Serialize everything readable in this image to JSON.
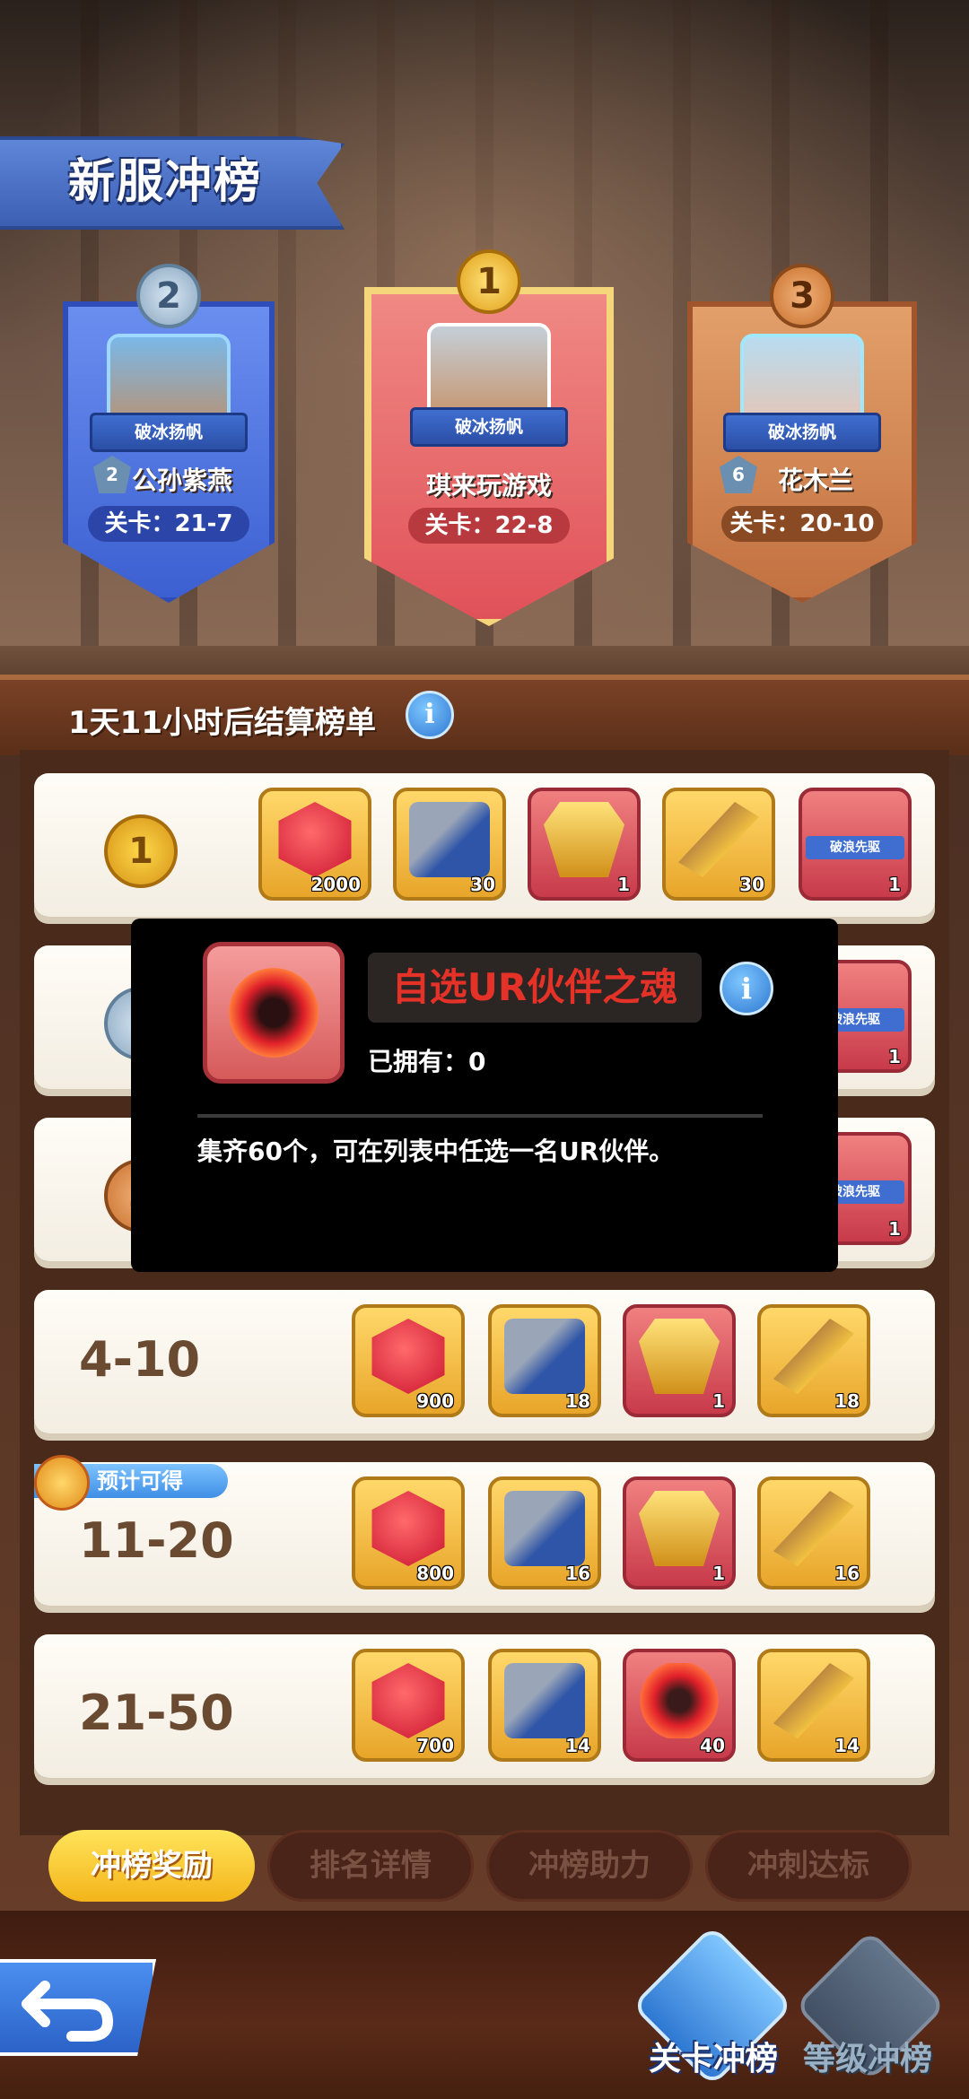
{
  "header": {
    "title": "新服冲榜"
  },
  "podium": [
    {
      "rank": "2",
      "badge": "破冰扬帆",
      "vip": "2",
      "name": "公孙紫燕",
      "level": "关卡：21-7"
    },
    {
      "rank": "1",
      "badge": "破冰扬帆",
      "name": "琪来玩游戏",
      "level": "关卡：22-8"
    },
    {
      "rank": "3",
      "badge": "破冰扬帆",
      "vip": "6",
      "name": "花木兰",
      "level": "关卡：20-10"
    }
  ],
  "settle": {
    "text": "1天11小时后结算榜单",
    "info": "i"
  },
  "rows": [
    {
      "rank": "1",
      "items": [
        {
          "icon": "red-gem-icon",
          "qty": "2000"
        },
        {
          "icon": "ticket-scroll-icon",
          "qty": "30"
        },
        {
          "icon": "golden-badge-icon",
          "qty": "1"
        },
        {
          "icon": "golden-horn-icon",
          "qty": "30"
        },
        {
          "icon": "title-banner-icon",
          "label": "破浪先驱",
          "qty": "1"
        }
      ]
    },
    {
      "rank": "2",
      "items": [
        {
          "icon": "title-banner-icon",
          "label": "破浪先驱",
          "qty": "1"
        }
      ]
    },
    {
      "rank": "3",
      "items": [
        {
          "icon": "title-banner-icon",
          "label": "破浪先驱",
          "qty": "1"
        }
      ]
    },
    {
      "label": "4-10",
      "items": [
        {
          "icon": "red-gem-icon",
          "qty": "900"
        },
        {
          "icon": "ticket-scroll-icon",
          "qty": "18"
        },
        {
          "icon": "golden-badge-icon",
          "qty": "1"
        },
        {
          "icon": "golden-horn-icon",
          "qty": "18"
        }
      ]
    },
    {
      "label": "11-20",
      "tag": "预计可得",
      "items": [
        {
          "icon": "red-gem-icon",
          "qty": "800"
        },
        {
          "icon": "ticket-scroll-icon",
          "qty": "16"
        },
        {
          "icon": "golden-badge-icon",
          "qty": "1"
        },
        {
          "icon": "golden-horn-icon",
          "qty": "16"
        }
      ]
    },
    {
      "label": "21-50",
      "items": [
        {
          "icon": "red-gem-icon",
          "qty": "700"
        },
        {
          "icon": "ticket-scroll-icon",
          "qty": "14"
        },
        {
          "icon": "skull-soul-icon",
          "qty": "40"
        },
        {
          "icon": "golden-horn-icon",
          "qty": "14"
        }
      ]
    }
  ],
  "popup": {
    "title": "自选UR伙伴之魂",
    "owned": "已拥有：0",
    "description": "集齐60个，可在列表中任选一名UR伙伴。",
    "info": "i"
  },
  "tabs": [
    {
      "label": "冲榜奖励",
      "active": true
    },
    {
      "label": "排名详情"
    },
    {
      "label": "冲榜助力"
    },
    {
      "label": "冲刺达标"
    }
  ],
  "footer": {
    "nav1": "关卡冲榜",
    "nav2": "等级冲榜"
  },
  "colors": {
    "accent_gold": "#f3b41a",
    "popup_title": "#e53228",
    "info_blue": "#2f78d2"
  }
}
